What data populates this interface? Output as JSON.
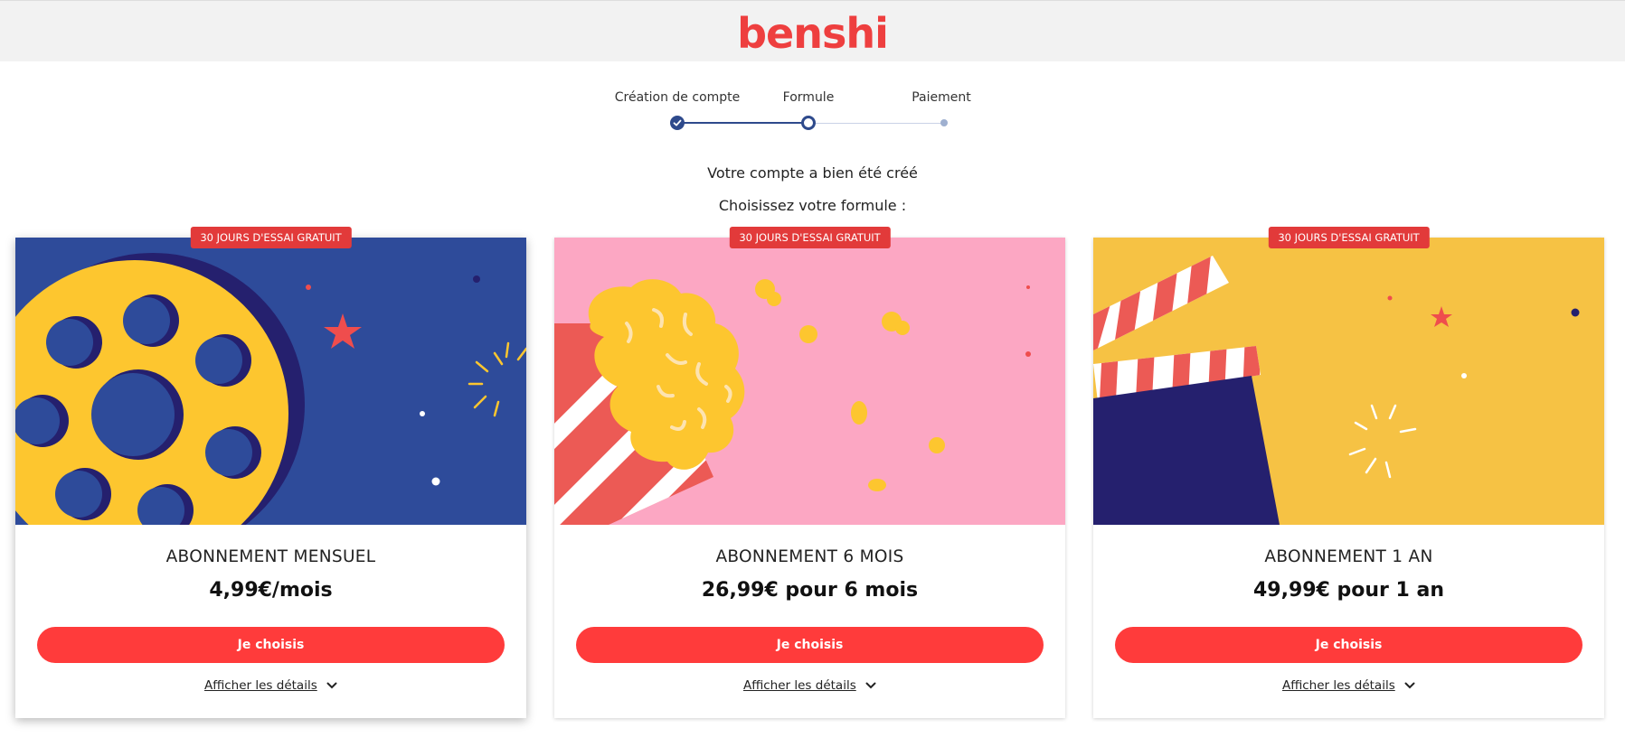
{
  "header": {
    "logo_text": "benshi"
  },
  "stepper": {
    "steps": [
      {
        "label": "Création de compte",
        "state": "done"
      },
      {
        "label": "Formule",
        "state": "current"
      },
      {
        "label": "Paiement",
        "state": "pending"
      }
    ]
  },
  "messages": {
    "account_created": "Votre compte a bien été créé",
    "choose_plan": "Choisissez votre formule :"
  },
  "plans": [
    {
      "badge": "30 JOURS D'ESSAI GRATUIT",
      "title": "ABONNEMENT MENSUEL",
      "price": "4,99€/mois",
      "button": "Je choisis",
      "details": "Afficher les détails",
      "image": "film-reel-illustration"
    },
    {
      "badge": "30 JOURS D'ESSAI GRATUIT",
      "title": "ABONNEMENT 6 MOIS",
      "price": "26,99€ pour 6 mois",
      "button": "Je choisis",
      "details": "Afficher les détails",
      "image": "popcorn-illustration"
    },
    {
      "badge": "30 JOURS D'ESSAI GRATUIT",
      "title": "ABONNEMENT 1 AN",
      "price": "49,99€ pour 1 an",
      "button": "Je choisis",
      "details": "Afficher les détails",
      "image": "clapperboard-illustration"
    }
  ],
  "colors": {
    "brand": "#ee3f3f",
    "button": "#ff3b3b",
    "badge": "#e23a3a",
    "stepper_active": "#2e4a8c",
    "stepper_pending": "#9fb0d0",
    "card1_bg": "#2e4b9a",
    "card2_bg": "#fca7c3",
    "card3_bg": "#f6c244"
  }
}
